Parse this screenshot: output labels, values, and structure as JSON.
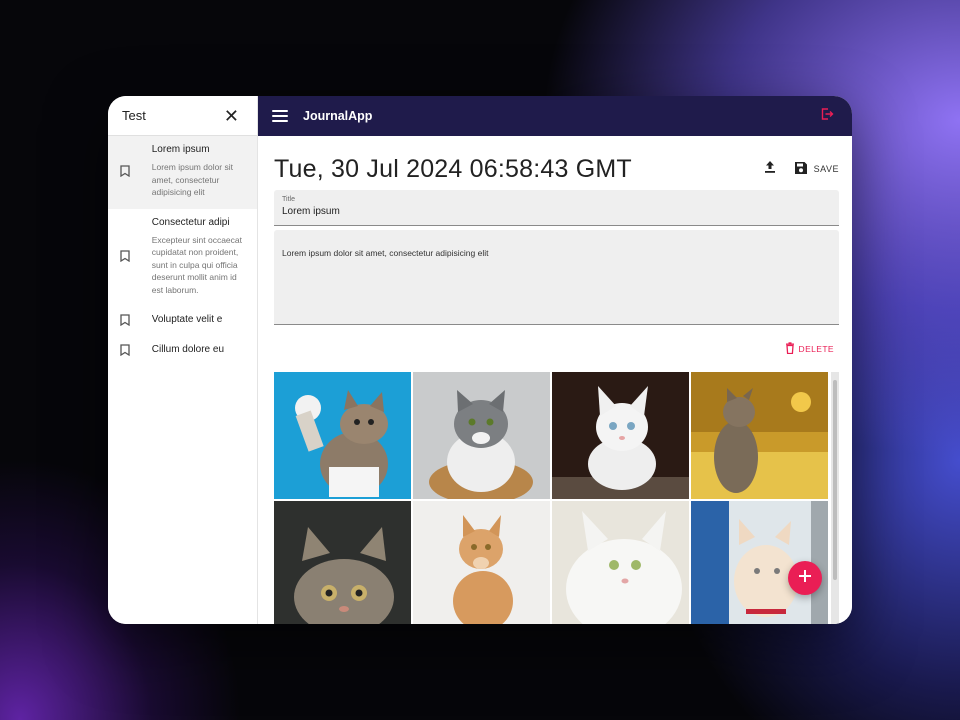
{
  "sidebar": {
    "title": "Test",
    "entries": [
      {
        "title": "Lorem ipsum",
        "body": "Lorem ipsum dolor sit amet, consectetur adipisicing elit",
        "active": true
      },
      {
        "title": "Consectetur adipi",
        "body": "Excepteur sint occaecat cupidatat non proident, sunt in culpa qui officia deserunt mollit anim id est laborum.",
        "active": false
      },
      {
        "title": "Voluptate velit e",
        "body": "",
        "active": false
      },
      {
        "title": "Cillum dolore eu",
        "body": "",
        "active": false
      }
    ]
  },
  "topbar": {
    "app_title": "JournalApp"
  },
  "note": {
    "date": "Tue, 30 Jul 2024 06:58:43 GMT",
    "save_label": "SAVE",
    "title_label": "Title",
    "title_value": "Lorem ipsum",
    "body_value": "Lorem ipsum dolor sit amet, consectetur adipisicing elit",
    "delete_label": "DELETE"
  },
  "colors": {
    "topbar": "#1f1b4b",
    "accent": "#ea1e55"
  },
  "icons": [
    "close-icon",
    "bookmark-icon",
    "menu-icon",
    "logout-icon",
    "upload-icon",
    "save-icon",
    "trash-icon",
    "plus-icon"
  ]
}
